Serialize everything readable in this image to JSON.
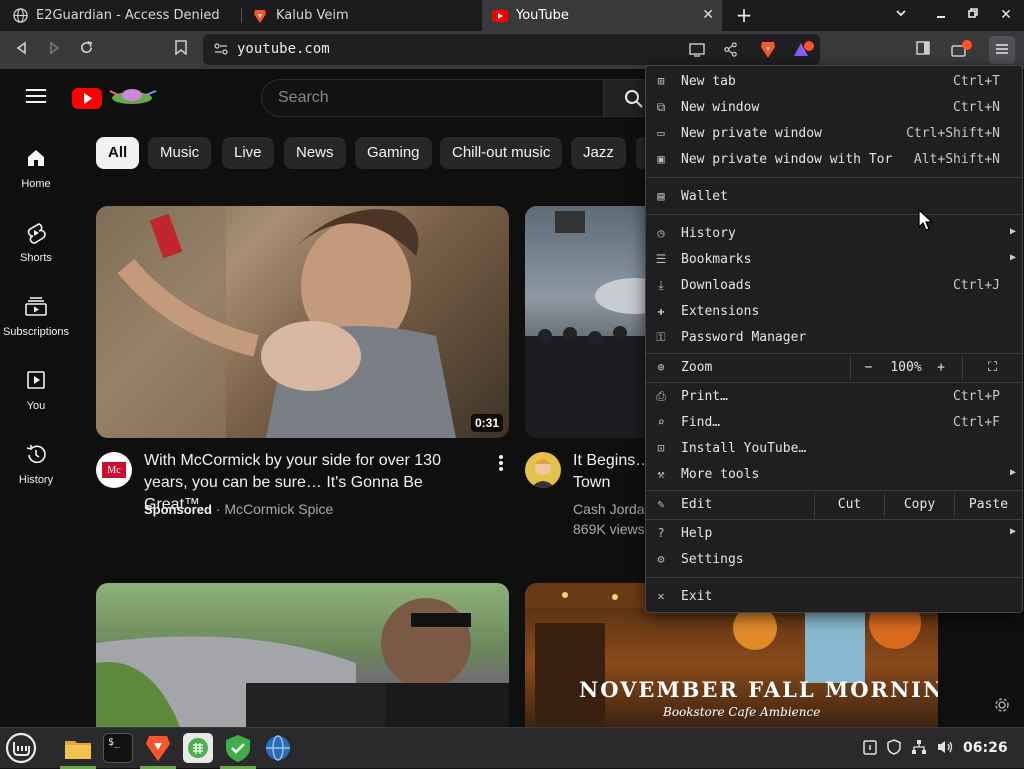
{
  "tabs": [
    {
      "title": "E2Guardian - Access Denied",
      "icon": "globe-icon",
      "active": false
    },
    {
      "title": "Kalub Veim",
      "icon": "brave-logo-icon",
      "active": false
    },
    {
      "title": "YouTube",
      "icon": "youtube-logo-icon",
      "active": true
    }
  ],
  "address": {
    "url": "youtube.com"
  },
  "youtube": {
    "search_placeholder": "Search",
    "sidebar": [
      {
        "label": "Home",
        "icon": "home-icon"
      },
      {
        "label": "Shorts",
        "icon": "shorts-icon"
      },
      {
        "label": "Subscriptions",
        "icon": "subscriptions-icon"
      },
      {
        "label": "You",
        "icon": "you-icon"
      },
      {
        "label": "History",
        "icon": "history-icon"
      }
    ],
    "chips": [
      "All",
      "Music",
      "Live",
      "News",
      "Gaming",
      "Chill-out music",
      "Jazz"
    ],
    "videos": [
      {
        "title_line1": "With McCormick by your side for over 130",
        "title_line2": "years, you can be sure… It's Gonna Be Great™.",
        "sponsored": "Sponsored",
        "channel": "McCormick Spice",
        "duration": "0:31"
      },
      {
        "title_line1": "It Begins…",
        "title_line2": "Town",
        "channel": "Cash Jorda",
        "views": "869K views"
      },
      {
        "overlay_title": "NOVEMBER FALL MORNING",
        "overlay_subtitle": "Bookstore Cafe Ambience"
      }
    ]
  },
  "menu": {
    "items": [
      {
        "label": "New tab",
        "shortcut": "Ctrl+T",
        "icon": "new-tab-icon"
      },
      {
        "label": "New window",
        "shortcut": "Ctrl+N",
        "icon": "new-window-icon"
      },
      {
        "label": "New private window",
        "shortcut": "Ctrl+Shift+N",
        "icon": "private-window-icon"
      },
      {
        "label": "New private window with Tor",
        "shortcut": "Alt+Shift+N",
        "icon": "tor-window-icon"
      },
      {
        "label": "Wallet",
        "shortcut": "",
        "icon": "wallet-icon"
      },
      {
        "label": "History",
        "shortcut": "",
        "icon": "history-icon",
        "submenu": true
      },
      {
        "label": "Bookmarks",
        "shortcut": "",
        "icon": "bookmarks-icon",
        "submenu": true
      },
      {
        "label": "Downloads",
        "shortcut": "Ctrl+J",
        "icon": "downloads-icon"
      },
      {
        "label": "Extensions",
        "shortcut": "",
        "icon": "extensions-icon"
      },
      {
        "label": "Password Manager",
        "shortcut": "",
        "icon": "key-icon"
      },
      {
        "label": "Print…",
        "shortcut": "Ctrl+P",
        "icon": "print-icon"
      },
      {
        "label": "Find…",
        "shortcut": "Ctrl+F",
        "icon": "find-icon"
      },
      {
        "label": "Install YouTube…",
        "shortcut": "",
        "icon": "install-icon"
      },
      {
        "label": "More tools",
        "shortcut": "",
        "icon": "tools-icon",
        "submenu": true
      },
      {
        "label": "Help",
        "shortcut": "",
        "icon": "help-icon",
        "submenu": true
      },
      {
        "label": "Settings",
        "shortcut": "",
        "icon": "settings-icon"
      },
      {
        "label": "Exit",
        "shortcut": "",
        "icon": "exit-icon"
      }
    ],
    "zoom": {
      "label": "Zoom",
      "minus": "−",
      "value": "100%",
      "plus": "+"
    },
    "edit": {
      "label": "Edit",
      "cut": "Cut",
      "copy": "Copy",
      "paste": "Paste"
    }
  },
  "taskbar": {
    "clock": "06:26"
  },
  "colors": {
    "youtube_red": "#ff0000",
    "menu_bg": "#1f1f21",
    "page_bg": "#0f0f0f",
    "brave_orange": "#fb542b",
    "taskbar_green": "#6aa84f"
  }
}
